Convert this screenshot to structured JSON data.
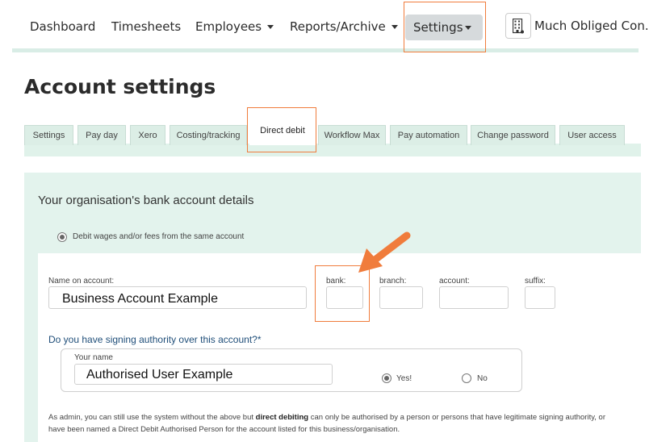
{
  "nav": {
    "dashboard": "Dashboard",
    "timesheets": "Timesheets",
    "employees": "Employees",
    "reports": "Reports/Archive",
    "settings": "Settings",
    "org_name": "Much Obliged Con..."
  },
  "page": {
    "title": "Account settings"
  },
  "tabs": [
    "Settings",
    "Pay day",
    "Xero",
    "Costing/tracking",
    "Direct debit",
    "Workflow Max",
    "Pay automation",
    "Change password",
    "User access"
  ],
  "active_tab": "Direct debit",
  "bank": {
    "heading": "Your organisation's bank account details",
    "debit_option": "Debit wages and/or fees from the same account",
    "name_label": "Name on account:",
    "name_value": "Business Account Example",
    "bank_label": "bank:",
    "branch_label": "branch:",
    "account_label": "account:",
    "suffix_label": "suffix:",
    "bank_value": "",
    "branch_value": "",
    "account_value": "",
    "suffix_value": ""
  },
  "authority": {
    "question": "Do you have signing authority over this account?*",
    "your_name_label": "Your name",
    "your_name_value": "Authorised User Example",
    "yes_label": "Yes!",
    "no_label": "No",
    "selected": "Yes!"
  },
  "note": {
    "before": "As admin, you can still use the system without the above but ",
    "bold": "direct debiting",
    "after": " can only be authorised by a person or persons that have legitimate signing authority, or have been named a Direct Debit Authorised Person for the account listed for this business/organisation."
  },
  "colors": {
    "highlight": "#f07c3c",
    "panel": "#e3f3ed",
    "tab": "#dceee6",
    "question": "#1f4e79"
  },
  "icons": {
    "org": "building-icon",
    "caret": "caret-down-icon",
    "annotation": "arrow-annotation"
  }
}
